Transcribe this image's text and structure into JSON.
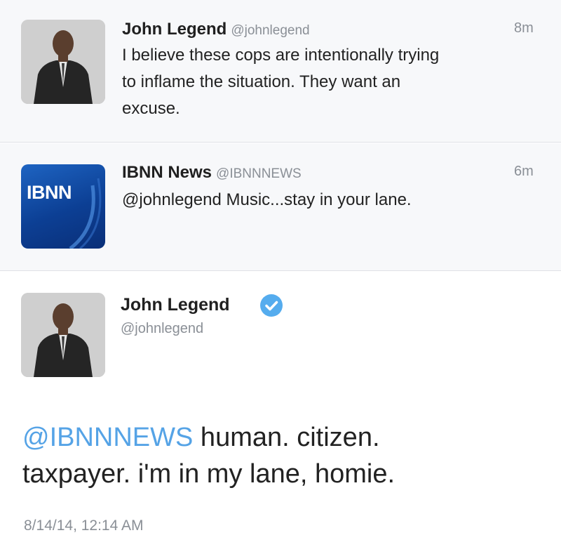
{
  "tweets": [
    {
      "name": "John Legend",
      "handle": "@johnlegend",
      "time": "8m",
      "text_lines": [
        "I believe these cops are intentionally trying",
        "to inflame the situation.  They want an",
        "excuse."
      ]
    },
    {
      "name": "IBNN News",
      "handle": "@IBNNNEWS",
      "time": "6m",
      "avatar_text": "IBNN",
      "text": "@johnlegend Music...stay in your lane."
    }
  ],
  "detail": {
    "name": "John Legend",
    "handle": "@johnlegend",
    "verified": true,
    "mention": "@IBNNNEWS",
    "text_line1_rest": " human.  citizen.",
    "text_line2": "taxpayer.  i'm in my lane, homie.",
    "timestamp": "8/14/14, 12:14 AM"
  },
  "colors": {
    "mention": "#55a3e6",
    "verified": "#55acee",
    "row_background": "#f7f8fa"
  }
}
